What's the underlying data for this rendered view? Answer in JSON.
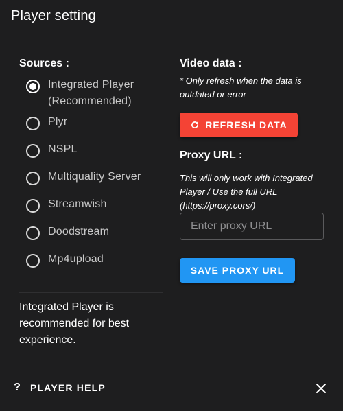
{
  "dialog": {
    "title": "Player setting"
  },
  "sources": {
    "label": "Sources :",
    "items": [
      {
        "label": "Integrated Player (Recommended)",
        "checked": true
      },
      {
        "label": "Plyr",
        "checked": false
      },
      {
        "label": "NSPL",
        "checked": false
      },
      {
        "label": "Multiquality Server",
        "checked": false
      },
      {
        "label": "Streamwish",
        "checked": false
      },
      {
        "label": "Doodstream",
        "checked": false
      },
      {
        "label": "Mp4upload",
        "checked": false
      }
    ],
    "note": "Integrated Player is recommended for best experience."
  },
  "video_data": {
    "label": "Video data :",
    "note": "* Only refresh when the data is outdated or error",
    "refresh_label": "REFRESH DATA",
    "refresh_icon": "refresh-icon",
    "refresh_color": "#f44335"
  },
  "proxy": {
    "label": "Proxy URL :",
    "note": "This will only work with Integrated Player / Use the full URL (https://proxy.cors/)",
    "placeholder": "Enter proxy URL",
    "value": "",
    "save_label": "SAVE PROXY URL",
    "save_color": "#2196f3"
  },
  "footer": {
    "help_icon": "?",
    "help_label": "PLAYER HELP",
    "close_icon": "close-icon"
  }
}
